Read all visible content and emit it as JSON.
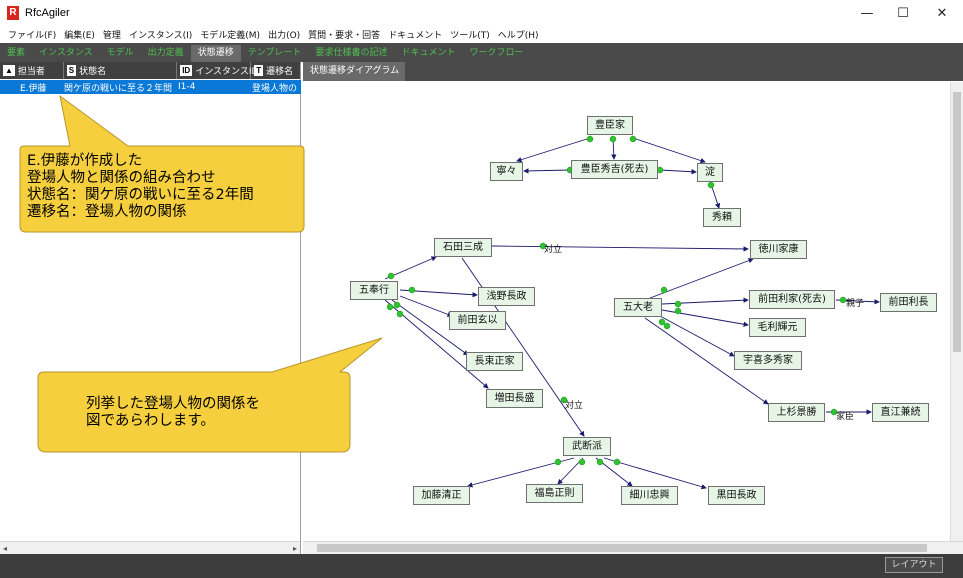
{
  "window": {
    "app_icon": "R",
    "title": "RfcAgiler",
    "minimize": "—",
    "maximize": "☐",
    "close": "✕"
  },
  "menu": [
    "ファイル(F)",
    "編集(E)",
    "管理",
    "インスタンス(I)",
    "モデル定義(M)",
    "出力(O)",
    "質問・要求・回答",
    "ドキュメント",
    "ツール(T)",
    "ヘルプ(H)"
  ],
  "toolbar": {
    "tabs": [
      "要素",
      "インスタンス",
      "モデル",
      "出力定義",
      "状態遷移",
      "テンプレート",
      "要求仕様書の記述",
      "ドキュメント",
      "ワークフロー"
    ],
    "active": "状態遷移"
  },
  "left_list": {
    "columns": [
      {
        "icon": "person-icon",
        "glyph": "▲",
        "label": "担当者"
      },
      {
        "icon": "state-icon",
        "glyph": "S",
        "label": "状態名"
      },
      {
        "icon": "id-icon",
        "glyph": "ID",
        "label": "インスタンスID"
      },
      {
        "icon": "transition-icon",
        "glyph": "T",
        "label": "遷移名"
      }
    ],
    "row": {
      "person": "E.伊藤",
      "state": "関ケ原の戦いに至る２年間",
      "id": "I1-4",
      "transition": "登場人物の"
    }
  },
  "callouts": {
    "top": "E.伊藤が作成した\n登場人物と関係の組み合わせ\n状態名：関ケ原の戦いに至る2年間\n遷移名：登場人物の関係",
    "bottom": "列挙した登場人物の関係を\n図であらわします。"
  },
  "diagram": {
    "tab_label": "状態遷移ダイアグラム",
    "nodes": {
      "toyotomi": "豊臣家",
      "nene": "寧々",
      "hideyoshi": "豊臣秀吉(死去)",
      "yodo": "淀",
      "hideyori": "秀頼",
      "ishida": "石田三成",
      "tokugawa": "徳川家康",
      "gobugyo": "五奉行",
      "asano": "浅野長政",
      "maeda_g": "前田玄以",
      "natsuka": "長束正家",
      "mashita": "増田長盛",
      "gotairo": "五大老",
      "maeda_t": "前田利家(死去)",
      "maeda_n": "前田利長",
      "mori": "毛利輝元",
      "ukita": "宇喜多秀家",
      "uesugi": "上杉景勝",
      "naoe": "直江兼続",
      "budan": "武断派",
      "kato": "加藤清正",
      "fukushima": "福島正則",
      "hosokawa": "細川忠興",
      "kuroda": "黒田長政"
    },
    "edge_labels": {
      "taiketsu1": "対立",
      "taiketsu2": "対立",
      "oyako": "親子",
      "kashin": "家臣"
    }
  },
  "statusbar": {
    "layout_button": "レイアウト"
  },
  "colors": {
    "accent_tab": "#4fc24f",
    "selection": "#0a78d7",
    "node_fill": "#e6f5e6",
    "callout_fill": "#f6cf3f",
    "edge_color": "#1a1a6e",
    "dot_color": "#2fc42f"
  }
}
